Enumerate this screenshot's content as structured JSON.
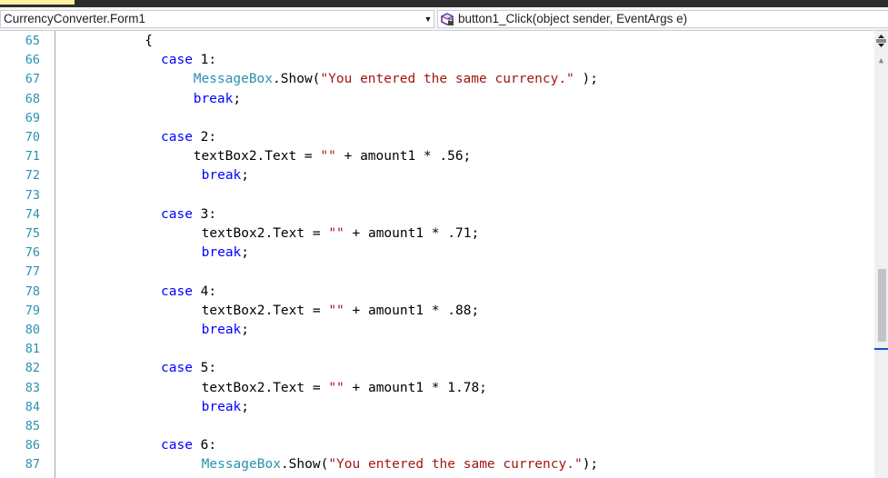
{
  "navigation": {
    "type_selector": "CurrencyConverter.Form1",
    "member_selector": "button1_Click(object sender, EventArgs e)",
    "member_icon": "method-icon"
  },
  "code_lines": [
    {
      "num": "65",
      "indent": 10,
      "tokens": [
        {
          "t": "{",
          "c": ""
        }
      ]
    },
    {
      "num": "66",
      "indent": 12,
      "tokens": [
        {
          "t": "case",
          "c": "kw"
        },
        {
          "t": " 1:",
          "c": ""
        }
      ]
    },
    {
      "num": "67",
      "indent": 16,
      "tokens": [
        {
          "t": "MessageBox",
          "c": "type"
        },
        {
          "t": ".Show(",
          "c": ""
        },
        {
          "t": "\"You entered the same currency.\"",
          "c": "str"
        },
        {
          "t": " );",
          "c": ""
        }
      ]
    },
    {
      "num": "68",
      "indent": 16,
      "tokens": [
        {
          "t": "break",
          "c": "kw"
        },
        {
          "t": ";",
          "c": ""
        }
      ]
    },
    {
      "num": "69",
      "indent": 0,
      "tokens": []
    },
    {
      "num": "70",
      "indent": 12,
      "tokens": [
        {
          "t": "case",
          "c": "kw"
        },
        {
          "t": " 2:",
          "c": ""
        }
      ]
    },
    {
      "num": "71",
      "indent": 16,
      "tokens": [
        {
          "t": "textBox2.Text = ",
          "c": ""
        },
        {
          "t": "\"\"",
          "c": "str"
        },
        {
          "t": " + amount1 * .56;",
          "c": ""
        }
      ]
    },
    {
      "num": "72",
      "indent": 17,
      "tokens": [
        {
          "t": "break",
          "c": "kw"
        },
        {
          "t": ";",
          "c": ""
        }
      ]
    },
    {
      "num": "73",
      "indent": 0,
      "tokens": []
    },
    {
      "num": "74",
      "indent": 12,
      "tokens": [
        {
          "t": "case",
          "c": "kw"
        },
        {
          "t": " 3:",
          "c": ""
        }
      ]
    },
    {
      "num": "75",
      "indent": 17,
      "tokens": [
        {
          "t": "textBox2.Text = ",
          "c": ""
        },
        {
          "t": "\"\"",
          "c": "str"
        },
        {
          "t": " + amount1 * .71;",
          "c": ""
        }
      ]
    },
    {
      "num": "76",
      "indent": 17,
      "tokens": [
        {
          "t": "break",
          "c": "kw"
        },
        {
          "t": ";",
          "c": ""
        }
      ]
    },
    {
      "num": "77",
      "indent": 0,
      "tokens": []
    },
    {
      "num": "78",
      "indent": 12,
      "tokens": [
        {
          "t": "case",
          "c": "kw"
        },
        {
          "t": " 4:",
          "c": ""
        }
      ]
    },
    {
      "num": "79",
      "indent": 17,
      "tokens": [
        {
          "t": "textBox2.Text = ",
          "c": ""
        },
        {
          "t": "\"\"",
          "c": "str"
        },
        {
          "t": " + amount1 * .88;",
          "c": ""
        }
      ]
    },
    {
      "num": "80",
      "indent": 17,
      "tokens": [
        {
          "t": "break",
          "c": "kw"
        },
        {
          "t": ";",
          "c": ""
        }
      ]
    },
    {
      "num": "81",
      "indent": 0,
      "tokens": []
    },
    {
      "num": "82",
      "indent": 12,
      "tokens": [
        {
          "t": "case",
          "c": "kw"
        },
        {
          "t": " 5:",
          "c": ""
        }
      ]
    },
    {
      "num": "83",
      "indent": 17,
      "tokens": [
        {
          "t": "textBox2.Text = ",
          "c": ""
        },
        {
          "t": "\"\"",
          "c": "str"
        },
        {
          "t": " + amount1 * 1.78;",
          "c": ""
        }
      ]
    },
    {
      "num": "84",
      "indent": 17,
      "tokens": [
        {
          "t": "break",
          "c": "kw"
        },
        {
          "t": ";",
          "c": ""
        }
      ]
    },
    {
      "num": "85",
      "indent": 0,
      "tokens": []
    },
    {
      "num": "86",
      "indent": 12,
      "tokens": [
        {
          "t": "case",
          "c": "kw"
        },
        {
          "t": " 6:",
          "c": ""
        }
      ]
    },
    {
      "num": "87",
      "indent": 17,
      "tokens": [
        {
          "t": "MessageBox",
          "c": "type"
        },
        {
          "t": ".Show(",
          "c": ""
        },
        {
          "t": "\"You entered the same currency.\"",
          "c": "str"
        },
        {
          "t": ");",
          "c": ""
        }
      ]
    }
  ],
  "colors": {
    "keyword": "#0000ff",
    "type": "#2b91af",
    "string": "#a31515",
    "line_number": "#2b91af"
  }
}
